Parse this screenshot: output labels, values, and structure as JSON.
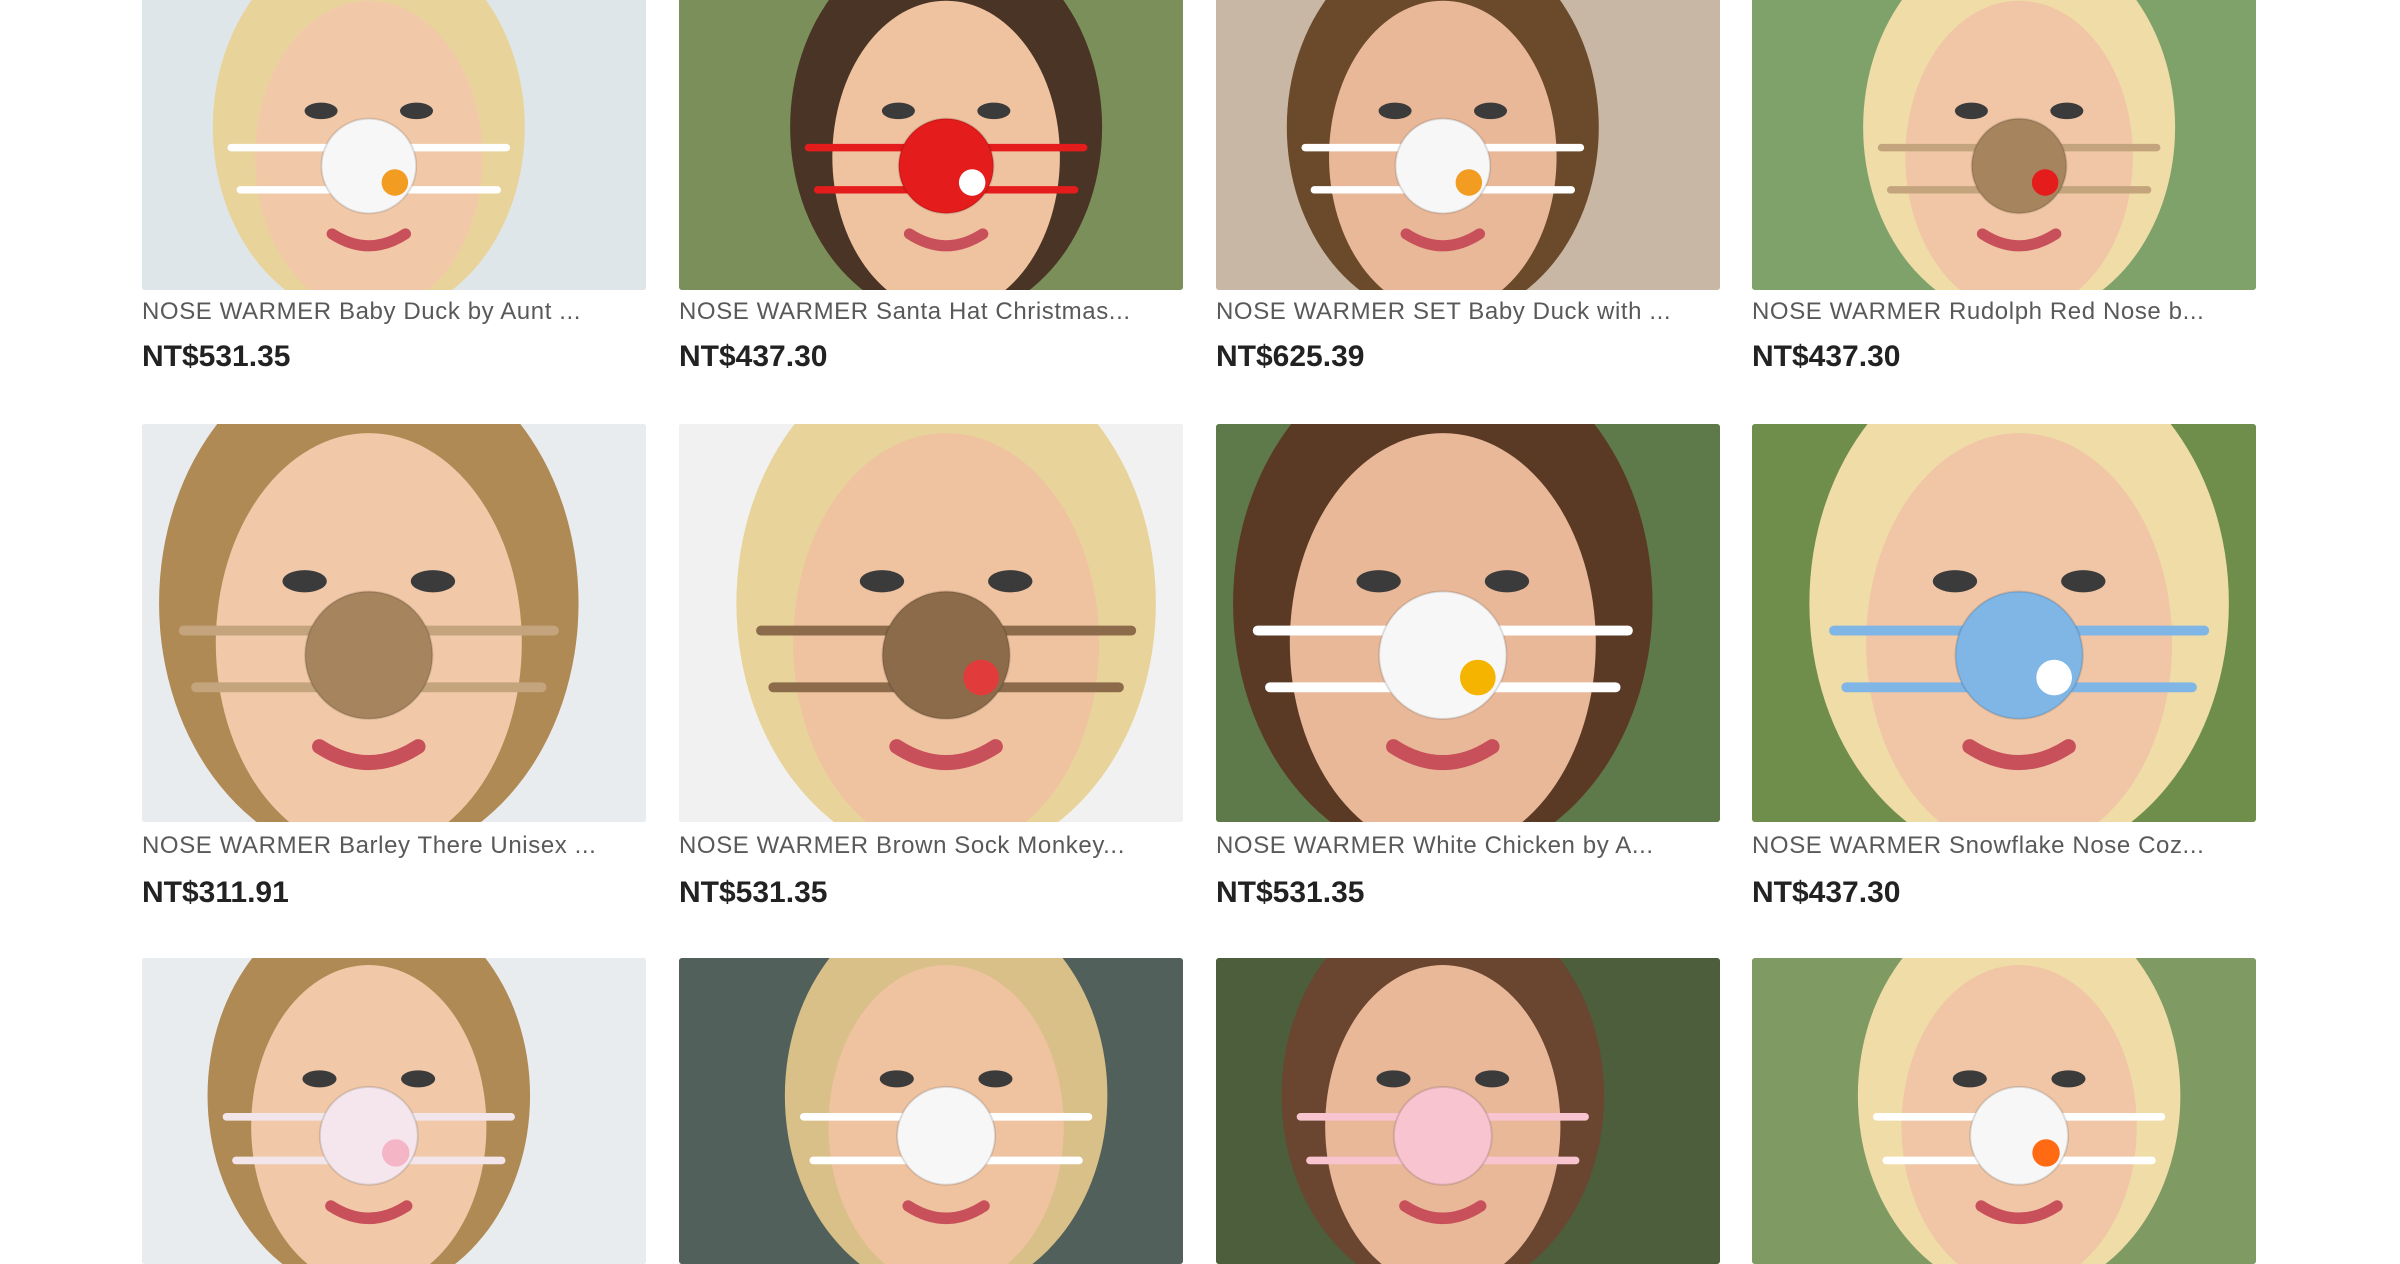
{
  "listings": [
    {
      "title": "NOSE WARMER Baby Duck by Aunt ...",
      "price": "NT$531.35",
      "accent": "#ffffff",
      "nose": "#f7f7f7",
      "beak": "#f39c22"
    },
    {
      "title": "NOSE WARMER Santa Hat Christmas...",
      "price": "NT$437.30",
      "accent": "#e51c1c",
      "nose": "#e51c1c",
      "beak": "#ffffff"
    },
    {
      "title": "NOSE WARMER SET Baby Duck with ...",
      "price": "NT$625.39",
      "accent": "#ffffff",
      "nose": "#f7f7f7",
      "beak": "#f39c22"
    },
    {
      "title": "NOSE WARMER Rudolph Red Nose b...",
      "price": "NT$437.30",
      "accent": "#c4a47c",
      "nose": "#a6845e",
      "beak": "#e51c1c"
    },
    {
      "title": "NOSE WARMER Barley There Unisex ...",
      "price": "NT$311.91",
      "accent": "#c4a47c",
      "nose": "#a6845e",
      "beak": "#a6845e"
    },
    {
      "title": "NOSE WARMER Brown Sock Monkey...",
      "price": "NT$531.35",
      "accent": "#8b6b4a",
      "nose": "#8b6b4a",
      "beak": "#e23b3b"
    },
    {
      "title": "NOSE WARMER White Chicken by A...",
      "price": "NT$531.35",
      "accent": "#ffffff",
      "nose": "#f7f7f7",
      "beak": "#f5b400"
    },
    {
      "title": "NOSE WARMER Snowflake Nose Coz...",
      "price": "NT$437.30",
      "accent": "#7fb6e6",
      "nose": "#7fb6e6",
      "beak": "#ffffff"
    },
    {
      "title": "",
      "price": "",
      "accent": "#f2e6ea",
      "nose": "#f4e6ec",
      "beak": "#f4b6c6"
    },
    {
      "title": "",
      "price": "",
      "accent": "#ffffff",
      "nose": "#f7f7f7",
      "beak": "#f7f7f7"
    },
    {
      "title": "",
      "price": "",
      "accent": "#f7c4cf",
      "nose": "#f7c4cf",
      "beak": "#f7c4cf"
    },
    {
      "title": "",
      "price": "",
      "accent": "#ffffff",
      "nose": "#f7f7f7",
      "beak": "#ff6a13"
    }
  ]
}
